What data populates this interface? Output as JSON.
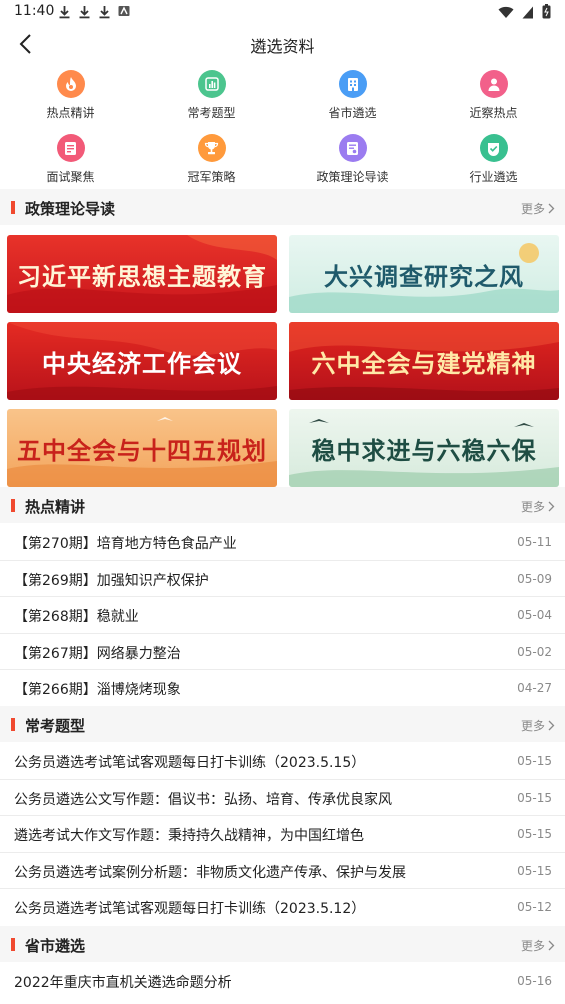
{
  "status_bar": {
    "time": "11:40"
  },
  "app_bar": {
    "title": "遴选资料"
  },
  "grid": [
    {
      "label": "热点精讲",
      "icon": "flame-icon",
      "color": "#ff8a4c"
    },
    {
      "label": "常考题型",
      "icon": "chart-icon",
      "color": "#4cc58e"
    },
    {
      "label": "省市遴选",
      "icon": "building-icon",
      "color": "#4a9df5"
    },
    {
      "label": "近察热点",
      "icon": "person-icon",
      "color": "#f2608a"
    },
    {
      "label": "面试聚焦",
      "icon": "document-icon",
      "color": "#f25a78"
    },
    {
      "label": "冠军策略",
      "icon": "trophy-icon",
      "color": "#ff9a3c"
    },
    {
      "label": "政策理论导读",
      "icon": "book-icon",
      "color": "#9b7cf0"
    },
    {
      "label": "行业遴选",
      "icon": "badge-check-icon",
      "color": "#39c090"
    }
  ],
  "sections": {
    "policy": {
      "title": "政策理论导读",
      "more": "更多"
    },
    "hot": {
      "title": "热点精讲",
      "more": "更多"
    },
    "common": {
      "title": "常考题型",
      "more": "更多"
    },
    "province": {
      "title": "省市遴选",
      "more": "更多"
    }
  },
  "banners": [
    {
      "text": "习近平新思想主题教育",
      "theme": "red"
    },
    {
      "text": "大兴调查研究之风",
      "theme": "mint"
    },
    {
      "text": "中央经济工作会议",
      "theme": "red"
    },
    {
      "text": "六中全会与建党精神",
      "theme": "red"
    },
    {
      "text": "五中全会与十四五规划",
      "theme": "orange"
    },
    {
      "text": "稳中求进与六稳六保",
      "theme": "jade"
    }
  ],
  "hot_list": [
    {
      "title": "【第270期】培育地方特色食品产业",
      "date": "05-11"
    },
    {
      "title": "【第269期】加强知识产权保护",
      "date": "05-09"
    },
    {
      "title": "【第268期】稳就业",
      "date": "05-04"
    },
    {
      "title": "【第267期】网络暴力整治",
      "date": "05-02"
    },
    {
      "title": "【第266期】淄博烧烤现象",
      "date": "04-27"
    }
  ],
  "common_list": [
    {
      "title": "公务员遴选考试笔试客观题每日打卡训练（2023.5.15）",
      "date": "05-15"
    },
    {
      "title": "公务员遴选公文写作题：倡议书：弘扬、培育、传承优良家风",
      "date": "05-15"
    },
    {
      "title": "遴选考试大作文写作题：秉持持久战精神，为中国红增色",
      "date": "05-15"
    },
    {
      "title": "公务员遴选考试案例分析题：非物质文化遗产传承、保护与发展",
      "date": "05-15"
    },
    {
      "title": "公务员遴选考试笔试客观题每日打卡训练（2023.5.12）",
      "date": "05-12"
    }
  ],
  "province_list": [
    {
      "title": "2022年重庆市直机关遴选命题分析",
      "date": "05-16"
    }
  ]
}
